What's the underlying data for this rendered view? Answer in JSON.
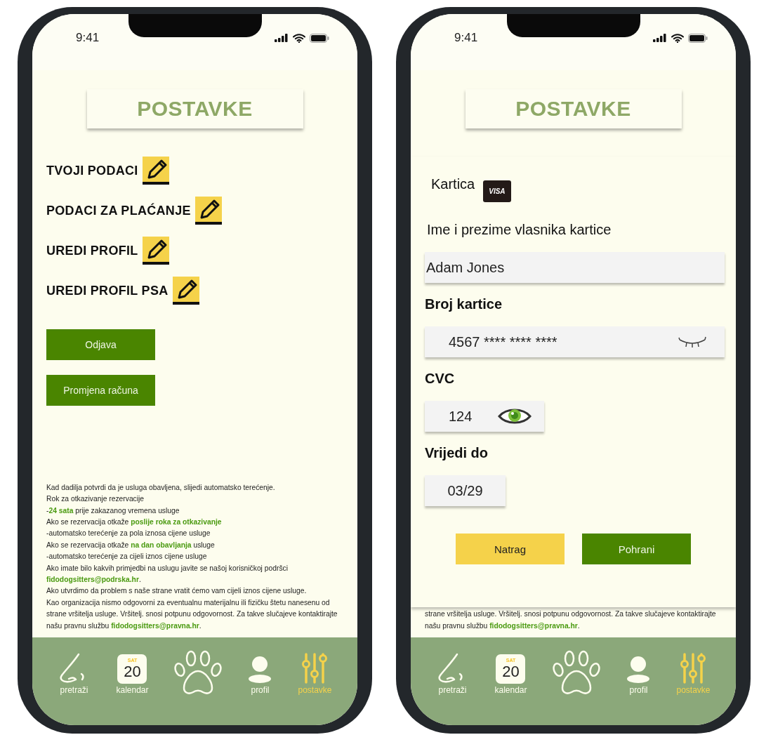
{
  "screens": [
    {
      "kind": "settings",
      "status_bar": {
        "time": "9:41"
      },
      "header": {
        "title": "POSTAVKE"
      },
      "menu": [
        {
          "label": "TVOJI PODACI"
        },
        {
          "label": "PODACI ZA PLAĆANJE"
        },
        {
          "label": "UREDI PROFIL"
        },
        {
          "label": "UREDI PROFIL PSA"
        }
      ],
      "buttons": [
        {
          "label": "Odjava"
        },
        {
          "label": "Promjena računa"
        }
      ],
      "terms": [
        "Kad dadilja potvrdi da je usluga obavljena, slijedi automatsko terećenje.",
        "Rok za otkazivanje rezervacije",
        "-**24 sata** prije zakazanog vremena usluge",
        "Ako se rezervacija otkaže **poslije roka za otkazivanje**",
        "-automatsko terećenje za pola iznosa cijene usluge",
        "Ako se rezervacija otkaže **na dan obavljanja** usluge",
        "-automatsko terećenje za cijeli iznos cijene usluge",
        "Ako imate bilo kakvih primjedbi na uslugu javite se našoj korisničkoj podršci",
        "**fidodogsitters@podrska.hr**.",
        "Ako utvrdimo da problem s naše strane vratit ćemo vam cijeli iznos cijene usluge.",
        "Kao organizacija nismo odgovorni za eventualnu materijalnu ili fizičku štetu nanesenu od",
        "strane vršitelja usluge. Vršitelj. snosi potpunu odgovornost. Za takve slučajeve kontaktirajte",
        "našu pravnu službu **fidodogsitters@pravna.hr**."
      ],
      "nav": [
        {
          "label": "pretraži",
          "selected": false
        },
        {
          "label": "kalendar",
          "day": "SAT",
          "date": "20",
          "selected": false
        },
        {
          "selected": false
        },
        {
          "label": "profil",
          "selected": false
        },
        {
          "label": "postavke",
          "selected": true
        }
      ]
    },
    {
      "kind": "payment",
      "status_bar": {
        "time": "9:41"
      },
      "header": {
        "title": "POSTAVKE"
      },
      "card_label": "Kartica",
      "card_brand": "VISA",
      "fields": [
        {
          "label": "Ime i prezime vlasnika kartice",
          "value": "Adam Jones",
          "kind": "name"
        },
        {
          "label": "Broj kartice",
          "value": "4567 **** **** ****",
          "kind": "number",
          "visible": false
        },
        {
          "label": "CVC",
          "value": "124",
          "kind": "cvc",
          "visible": true
        },
        {
          "label": "Vrijedi do",
          "value": "03/29",
          "kind": "expiry"
        }
      ],
      "buttons": [
        {
          "label": "Natrag",
          "kind": "secondary"
        },
        {
          "label": "Pohrani",
          "kind": "primary"
        }
      ],
      "terms": [
        "strane vršitelja usluge. Vršitelj. snosi potpunu odgovornost. Za takve slučajeve kontaktirajte",
        "našu pravnu službu **fidodogsitters@pravna.hr**."
      ],
      "nav": [
        {
          "label": "pretraži",
          "selected": false
        },
        {
          "label": "kalendar",
          "day": "SAT",
          "date": "20",
          "selected": false
        },
        {
          "selected": false
        },
        {
          "label": "profil",
          "selected": false
        },
        {
          "label": "postavke",
          "selected": true
        }
      ]
    }
  ]
}
